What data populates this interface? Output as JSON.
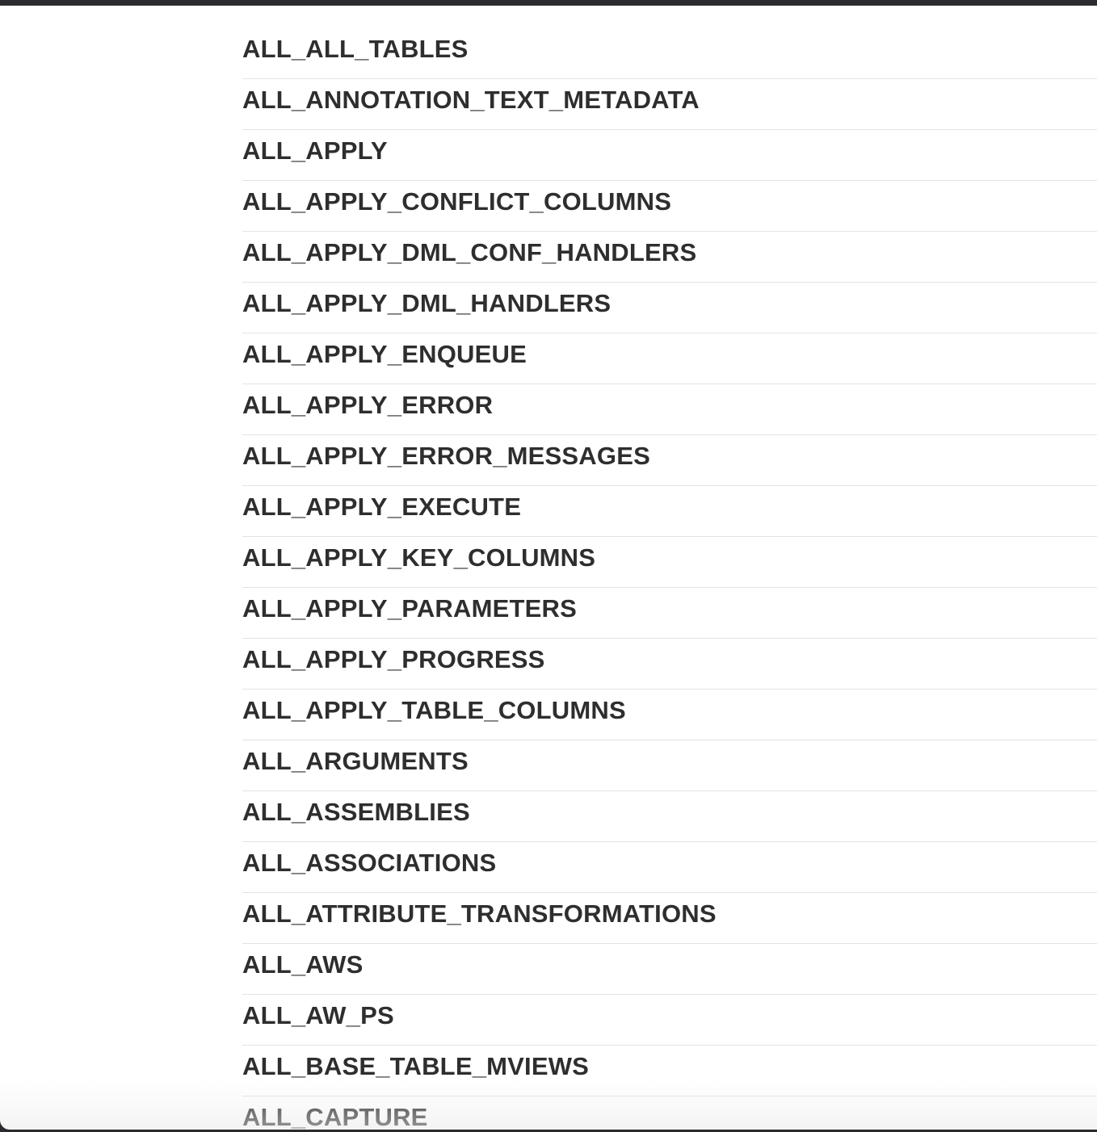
{
  "list": {
    "items": [
      "ALL_ALL_TABLES",
      "ALL_ANNOTATION_TEXT_METADATA",
      "ALL_APPLY",
      "ALL_APPLY_CONFLICT_COLUMNS",
      "ALL_APPLY_DML_CONF_HANDLERS",
      "ALL_APPLY_DML_HANDLERS",
      "ALL_APPLY_ENQUEUE",
      "ALL_APPLY_ERROR",
      "ALL_APPLY_ERROR_MESSAGES",
      "ALL_APPLY_EXECUTE",
      "ALL_APPLY_KEY_COLUMNS",
      "ALL_APPLY_PARAMETERS",
      "ALL_APPLY_PROGRESS",
      "ALL_APPLY_TABLE_COLUMNS",
      "ALL_ARGUMENTS",
      "ALL_ASSEMBLIES",
      "ALL_ASSOCIATIONS",
      "ALL_ATTRIBUTE_TRANSFORMATIONS",
      "ALL_AWS",
      "ALL_AW_PS",
      "ALL_BASE_TABLE_MVIEWS",
      "ALL_CAPTURE"
    ]
  }
}
